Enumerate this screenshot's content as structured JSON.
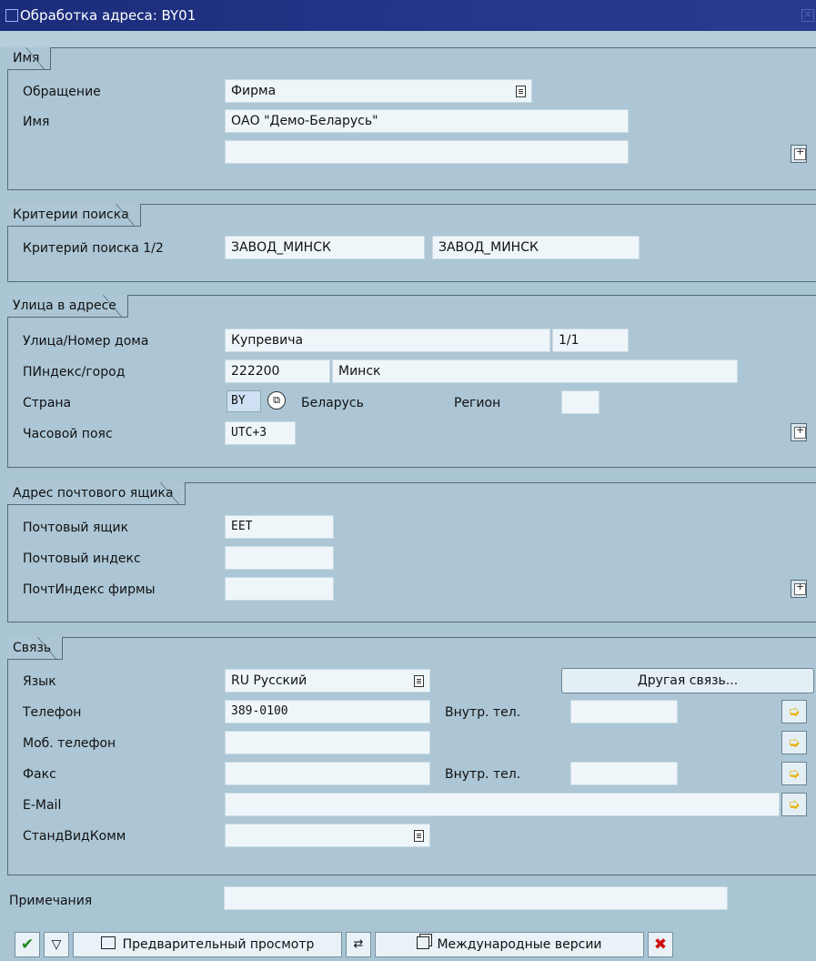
{
  "window": {
    "title": "Обработка адреса:  BY01"
  },
  "name_group": {
    "title": "Имя",
    "salutation_label": "Обращение",
    "salutation_value": "Фирма",
    "name_label": "Имя",
    "name_value": "ОАО \"Демо-Беларусь\"",
    "name2_value": ""
  },
  "search_group": {
    "title": "Критерии поиска",
    "criteria_label": "Критерий поиска 1/2",
    "criteria1_value": "ЗАВОД_МИНСК",
    "criteria2_value": "ЗАВОД_МИНСК"
  },
  "street_group": {
    "title": "Улица в адресе",
    "street_label": "Улица/Номер дома",
    "street_value": "Купревича",
    "house_value": "1/1",
    "postal_label": "ПИндекс/город",
    "postal_value": "222200",
    "city_value": "Минск",
    "country_label": "Страна",
    "country_code": "BY",
    "country_name": "Беларусь",
    "region_label": "Регион",
    "region_value": "",
    "timezone_label": "Часовой пояс",
    "timezone_value": "UTC+3"
  },
  "pobox_group": {
    "title": "Адрес почтового ящика",
    "pobox_label": "Почтовый ящик",
    "pobox_value": "EET",
    "pobox_postal_label": "Почтовый индекс",
    "pobox_postal_value": "",
    "company_postal_label": "ПочтИндекс фирмы",
    "company_postal_value": ""
  },
  "comm_group": {
    "title": "Связь",
    "language_label": "Язык",
    "language_value": "RU Русский",
    "other_comm_button": "Другая связь...",
    "phone_label": "Телефон",
    "phone_value": "389-0100",
    "ext_label": "Внутр. тел.",
    "ext_value": "",
    "mobile_label": "Моб. телефон",
    "mobile_value": "",
    "fax_label": "Факс",
    "fax_value": "",
    "fax_ext_label": "Внутр. тел.",
    "fax_ext_value": "",
    "email_label": "E-Mail",
    "email_value": "",
    "std_comm_label": "СтандВидКомм",
    "std_comm_value": ""
  },
  "notes": {
    "label": "Примечания",
    "value": ""
  },
  "toolbar": {
    "preview_label": "Предварительный просмотр",
    "intl_label": "Международные версии"
  },
  "colors": {
    "title_bar": "#1f2f80",
    "background": "#a9c5d4",
    "field": "#eef6fa",
    "confirm": "#1a8a1a",
    "cancel": "#d01010"
  }
}
